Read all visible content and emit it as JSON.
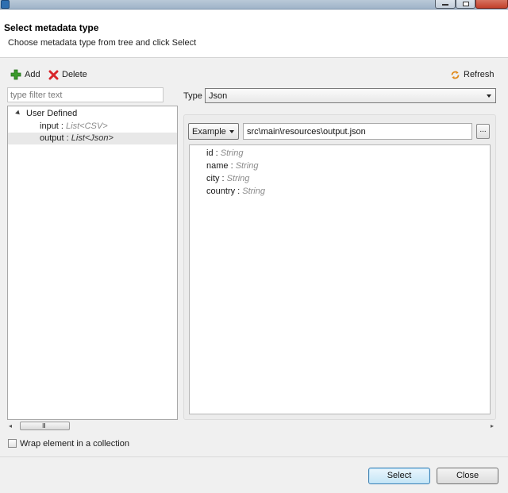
{
  "window": {
    "controls": [
      "minimize",
      "maximize",
      "close"
    ]
  },
  "header": {
    "title": "Select metadata type",
    "description": "Choose metadata type from tree and click Select"
  },
  "toolbar": {
    "add_label": "Add",
    "delete_label": "Delete",
    "refresh_label": "Refresh"
  },
  "filter": {
    "placeholder": "type filter text",
    "value": ""
  },
  "tree": {
    "root_label": "User Defined",
    "items": [
      {
        "name": "input",
        "sep": " : ",
        "type": "List<CSV>",
        "selected": false
      },
      {
        "name": "output",
        "sep": " : ",
        "type": "List<Json>",
        "selected": true
      }
    ]
  },
  "scrollbar": {
    "left_arrow": "◂",
    "right_arrow": "▸",
    "grip": "III"
  },
  "type_field": {
    "label": "Type",
    "value": "Json"
  },
  "source": {
    "mode": "Example",
    "path": "src\\main\\resources\\output.json",
    "browse_label": "..."
  },
  "schema_fields": [
    {
      "name": "id",
      "sep": " : ",
      "type": "String"
    },
    {
      "name": "name",
      "sep": " : ",
      "type": "String"
    },
    {
      "name": "city",
      "sep": " : ",
      "type": "String"
    },
    {
      "name": "country",
      "sep": " : ",
      "type": "String"
    }
  ],
  "options": {
    "wrap_label": "Wrap element in a collection",
    "wrap_checked": false
  },
  "buttons": {
    "select_label": "Select",
    "close_label": "Close"
  },
  "colors": {
    "add_icon": "#3a9a2a",
    "delete_icon": "#d8262b",
    "refresh_icon": "#e08a1c",
    "select_button_border": "#3c7fb1"
  }
}
